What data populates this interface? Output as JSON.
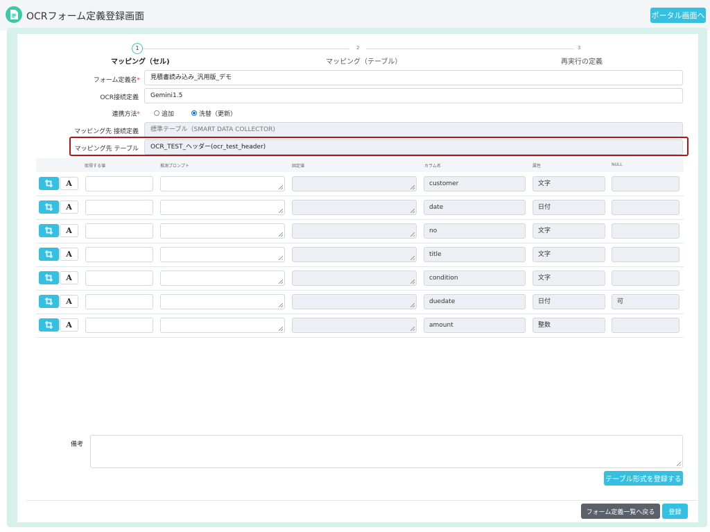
{
  "header": {
    "title": "OCRフォーム定義登録画面",
    "portal_button": "ポータル画面へ"
  },
  "stepper": {
    "steps": [
      {
        "number": "1",
        "label": "マッピング（セル)",
        "active": true
      },
      {
        "number": "2",
        "label": "マッピング（テーブル）",
        "active": false
      },
      {
        "number": "3",
        "label": "再実行の定義",
        "active": false
      }
    ]
  },
  "form": {
    "form_name_label": "フォーム定義名",
    "form_name_value": "見積書読み込み_汎用版_デモ",
    "ocr_connection_label": "OCR接続定義",
    "ocr_connection_value": "Gemini1.5",
    "link_method_label": "連携方法",
    "link_method_options": [
      "追加",
      "洗替（更新）"
    ],
    "link_method_selected": "洗替（更新）",
    "mapping_connection_label": "マッピング先 接続定義",
    "mapping_connection_value": "標準テーブル（SMART DATA COLLECTOR)",
    "mapping_table_label": "マッピング先 テーブル",
    "mapping_table_value": "OCR_TEST_ヘッダー(ocr_test_header)",
    "required_mark": "*"
  },
  "table": {
    "headers": [
      "取得する値",
      "推測プロンプト",
      "固定値",
      "カラム名",
      "属性",
      "NULL"
    ],
    "crop_icon": "crop-icon",
    "text_button_label": "A",
    "rows": [
      {
        "column": "customer",
        "type": "文字",
        "null": ""
      },
      {
        "column": "date",
        "type": "日付",
        "null": ""
      },
      {
        "column": "no",
        "type": "文字",
        "null": ""
      },
      {
        "column": "title",
        "type": "文字",
        "null": ""
      },
      {
        "column": "condition",
        "type": "文字",
        "null": ""
      },
      {
        "column": "duedate",
        "type": "日付",
        "null": "可"
      },
      {
        "column": "amount",
        "type": "整数",
        "null": ""
      }
    ]
  },
  "remarks": {
    "label": "備考",
    "value": ""
  },
  "buttons": {
    "register_table_format": "テーブル形式を登録する",
    "back_to_list": "フォーム定義一覧へ戻る",
    "register": "登録"
  },
  "colors": {
    "accent": "#35bfe0",
    "brand_green": "#3cc9a6",
    "highlight": "#b01515",
    "dark_button": "#5b6168"
  }
}
